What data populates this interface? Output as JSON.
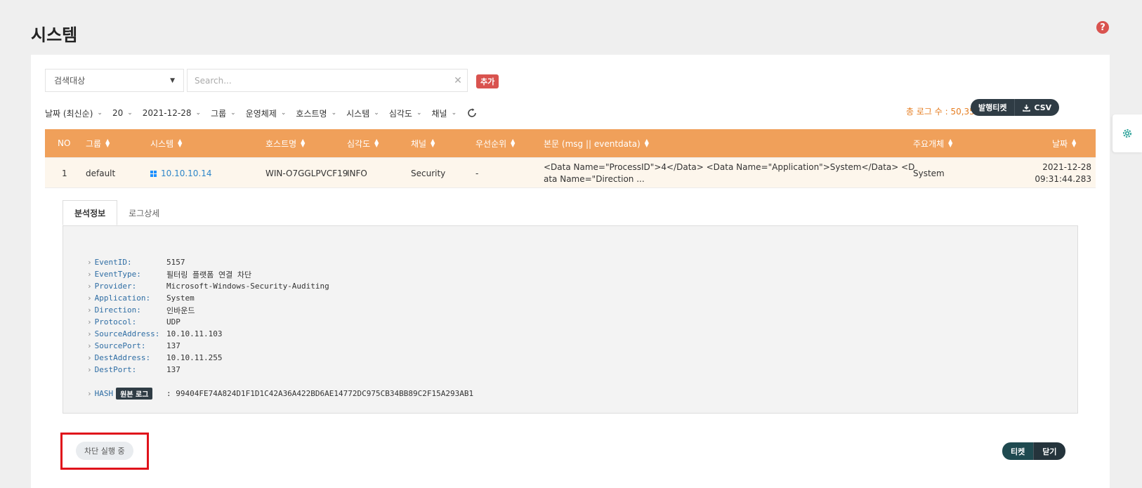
{
  "page": {
    "title": "시스템"
  },
  "search": {
    "target_label": "검색대상",
    "placeholder": "Search...",
    "add_label": "추가"
  },
  "filters": [
    {
      "label": "날짜 (최신순)"
    },
    {
      "label": "20"
    },
    {
      "label": "2021-12-28"
    },
    {
      "label": "그룹"
    },
    {
      "label": "운영체제"
    },
    {
      "label": "호스트명"
    },
    {
      "label": "시스템"
    },
    {
      "label": "심각도"
    },
    {
      "label": "채널"
    }
  ],
  "summary": {
    "total_label": "총 로그 수 : 50,350",
    "ticket_btn": "발행티켓",
    "csv_btn": "CSV"
  },
  "table": {
    "headers": [
      "NO",
      "그룹",
      "시스템",
      "호스트명",
      "심각도",
      "채널",
      "우선순위",
      "본문 (msg || eventdata)",
      "주요개체",
      "날짜"
    ],
    "rows": [
      {
        "no": "1",
        "group": "default",
        "system": "10.10.10.14",
        "host": "WIN-O7GGLPVCF19",
        "severity": "INFO",
        "channel": "Security",
        "priority": "-",
        "body": "<Data Name=\"ProcessID\">4</Data> <Data Name=\"Application\">System</Data> <Data Name=\"Direction ...",
        "entity": "System",
        "date": "2021-12-28",
        "time": "09:31:44.283"
      }
    ]
  },
  "detail": {
    "tabs": [
      "분석정보",
      "로그상세"
    ],
    "fields": [
      {
        "key": "EventID:",
        "value": "5157"
      },
      {
        "key": "EventType:",
        "value": "필터링 플랫폼 연결 차단"
      },
      {
        "key": "Provider:",
        "value": "Microsoft-Windows-Security-Auditing"
      },
      {
        "key": "Application:",
        "value": "System"
      },
      {
        "key": "Direction:",
        "value": "인바운드"
      },
      {
        "key": "Protocol:",
        "value": "UDP"
      },
      {
        "key": "SourceAddress:",
        "value": "10.10.11.103"
      },
      {
        "key": "SourcePort:",
        "value": "137"
      },
      {
        "key": "DestAddress:",
        "value": "10.10.11.255"
      },
      {
        "key": "DestPort:",
        "value": "137"
      }
    ],
    "hash": {
      "key": "HASH",
      "badge": "원본 로그",
      "value": ": 99404FE74A824D1F1D1C42A36A422BD6AE14772DC975CB34BB89C2F15A293AB1"
    }
  },
  "footer": {
    "block_status": "차단 실행 중",
    "ticket_btn": "티켓",
    "close_btn": "닫기"
  },
  "icons": {
    "help": "question-circle-icon",
    "settings": "gear-icon",
    "clear": "close-icon",
    "refresh": "refresh-icon",
    "download": "download-icon",
    "windows": "windows-icon"
  },
  "colors": {
    "header_bg": "#f0a05a",
    "accent_red": "#d9534f",
    "total_text": "#e67e22",
    "link": "#2e86c9",
    "highlight": "#e0121b"
  }
}
